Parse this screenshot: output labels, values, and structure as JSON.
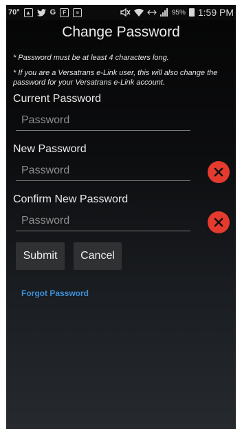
{
  "status_bar": {
    "temperature": "70°",
    "battery_percent": "95%",
    "time": "1:59 PM",
    "notification_icons": [
      "gallery-icon",
      "twitter-icon",
      "google-icon",
      "flipboard-icon",
      "clipboard-icon",
      "mute-icon",
      "wifi-icon",
      "no-sim-icon",
      "signal-icon"
    ]
  },
  "page": {
    "title": "Change Password"
  },
  "notes": {
    "length_rule": "* Password must be at least 4 characters long.",
    "elink_note": "* If you are a Versatrans e-Link user, this will also change the password for your Versatrans e-Link account."
  },
  "form": {
    "current": {
      "label": "Current Password",
      "placeholder": "Password",
      "value": ""
    },
    "new": {
      "label": "New Password",
      "placeholder": "Password",
      "value": "",
      "error": true
    },
    "confirm": {
      "label": "Confirm New Password",
      "placeholder": "Password",
      "value": "",
      "error": true
    }
  },
  "buttons": {
    "submit_label": "Submit",
    "cancel_label": "Cancel"
  },
  "links": {
    "forgot_password": "Forgot Password"
  },
  "colors": {
    "error_red": "#e53b2e",
    "link_blue": "#3c8fd6",
    "button_bg": "#2f3133"
  }
}
